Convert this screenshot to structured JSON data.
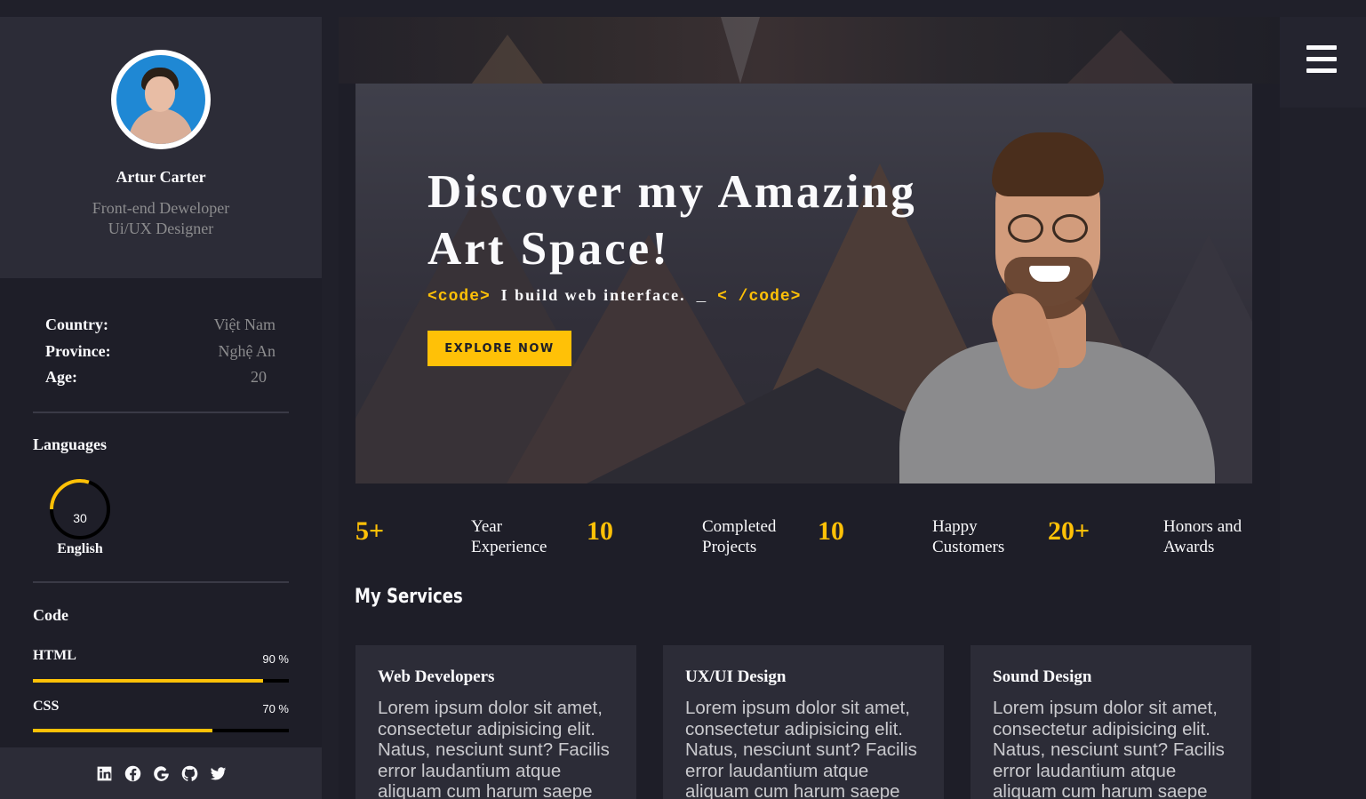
{
  "profile": {
    "name": "Artur Carter",
    "role_line1": "Front-end Deweloper",
    "role_line2": "Ui/UX Designer"
  },
  "info": [
    {
      "key": "Country:",
      "value": "Việt Nam"
    },
    {
      "key": "Province:",
      "value": "Nghệ An"
    },
    {
      "key": "Age:",
      "value": "20"
    }
  ],
  "languages": {
    "title": "Languages",
    "items": [
      {
        "name": "English",
        "value": "30",
        "level": 0.3
      }
    ]
  },
  "code": {
    "title": "Code",
    "skills": [
      {
        "name": "HTML",
        "percent_label": "90 %",
        "level": 0.9
      },
      {
        "name": "CSS",
        "percent_label": "70 %",
        "level": 0.7
      }
    ]
  },
  "socials": [
    "linkedin-icon",
    "facebook-icon",
    "google-icon",
    "github-icon",
    "twitter-icon"
  ],
  "hero": {
    "title_line1": "Discover my Amazing",
    "title_line2": "Art Space!",
    "code_open": "<code>",
    "code_text": "I build web interface.",
    "cursor": "_",
    "code_close": "< /code>",
    "button_label": "EXPLORE NOW"
  },
  "stats": [
    {
      "number": "5+",
      "label_line1": "Year",
      "label_line2": "Experience"
    },
    {
      "number": "10",
      "label_line1": "Completed",
      "label_line2": "Projects"
    },
    {
      "number": "10",
      "label_line1": "Happy",
      "label_line2": "Customers"
    },
    {
      "number": "20+",
      "label_line1": "Honors and",
      "label_line2": "Awards"
    }
  ],
  "services": {
    "title": "My Services",
    "cards": [
      {
        "title": "Web Developers",
        "text": "Lorem ipsum dolor sit amet, consectetur adipisicing elit. Natus, nesciunt sunt? Facilis error laudantium atque aliquam cum harum saepe"
      },
      {
        "title": "UX/UI Design",
        "text": "Lorem ipsum dolor sit amet, consectetur adipisicing elit. Natus, nesciunt sunt? Facilis error laudantium atque aliquam cum harum saepe"
      },
      {
        "title": "Sound Design",
        "text": "Lorem ipsum dolor sit amet, consectetur adipisicing elit. Natus, nesciunt sunt? Facilis error laudantium atque aliquam cum harum saepe"
      }
    ]
  },
  "colors": {
    "accent": "#ffc107",
    "panel": "#2c2c37",
    "background": "#1e1e28"
  }
}
